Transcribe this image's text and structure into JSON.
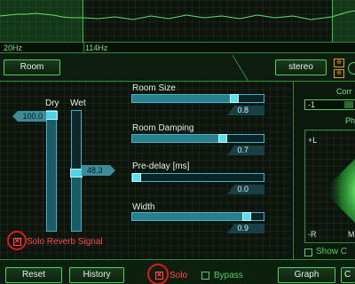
{
  "spectrum": {
    "freq_labels": [
      "20Hz",
      "114Hz"
    ]
  },
  "header": {
    "room_button": "Room",
    "stereo_button": "stereo"
  },
  "mix": {
    "dry_label": "Dry",
    "wet_label": "Wet",
    "dry_value": "100.0",
    "wet_value": "48.3",
    "dry_level": 1.0,
    "wet_level": 0.483
  },
  "params": [
    {
      "label": "Room Size",
      "value": "0.8",
      "level": 0.8
    },
    {
      "label": "Room Damping",
      "value": "0.7",
      "level": 0.7
    },
    {
      "label": "Pre-delay [ms]",
      "value": "0.0",
      "level": 0.0
    },
    {
      "label": "Width",
      "value": "0.9",
      "level": 0.9
    }
  ],
  "solo_reverb": {
    "label": "Solo Reverb Signal",
    "checked": true
  },
  "right_panel": {
    "corr_label": "Corr",
    "corr_value": "-1",
    "phase_label": "Ph",
    "plus_l": "+L",
    "minus_r": "-R",
    "m_label": "M",
    "show_label": "Show C"
  },
  "bottom": {
    "reset": "Reset",
    "history": "History",
    "solo": "Solo",
    "bypass": "Bypass",
    "graph": "Graph",
    "extra": "C"
  },
  "colors": {
    "accent_green": "#4ed15a",
    "accent_cyan": "#4fd3e6",
    "alert_red": "#e11919"
  }
}
